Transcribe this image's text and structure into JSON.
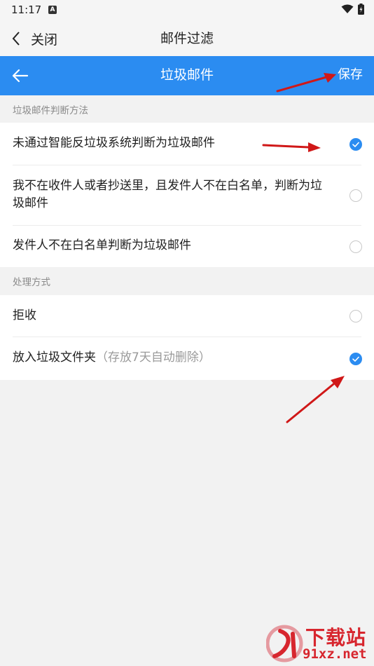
{
  "status_bar": {
    "time": "11:17",
    "app_icon_letter": "A"
  },
  "top_nav": {
    "close_label": "关闭",
    "title": "邮件过滤"
  },
  "header": {
    "title": "垃圾邮件",
    "save_label": "保存"
  },
  "judgement_section": {
    "label": "垃圾邮件判断方法",
    "options": [
      {
        "label": "未通过智能反垃圾系统判断为垃圾邮件",
        "checked": true
      },
      {
        "label": "我不在收件人或者抄送里，且发件人不在白名单，判断为垃圾邮件",
        "checked": false
      },
      {
        "label": "发件人不在白名单判断为垃圾邮件",
        "checked": false
      }
    ]
  },
  "handling_section": {
    "label": "处理方式",
    "options": [
      {
        "label": "拒收",
        "note": "",
        "checked": false
      },
      {
        "label": "放入垃圾文件夹",
        "note": "（存放7天自动删除）",
        "checked": true
      }
    ]
  },
  "watermark": {
    "top_text": "下载站",
    "bottom_text": "91xz.net"
  },
  "colors": {
    "accent": "#2b8cf1",
    "arrow": "#d01818",
    "background": "#f2f2f2"
  }
}
